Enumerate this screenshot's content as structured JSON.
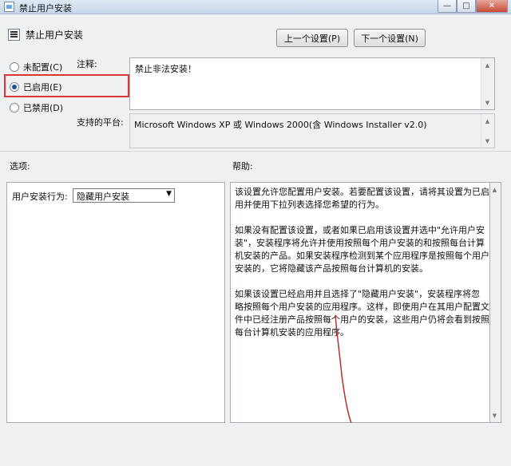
{
  "window": {
    "title": "禁止用户安装",
    "minimize_glyph": "—",
    "maximize_glyph": "□",
    "close_glyph": "✕"
  },
  "header": {
    "title": "禁止用户安装",
    "prev_button": "上一个设置(P)",
    "next_button": "下一个设置(N)"
  },
  "state": {
    "options": [
      {
        "label": "未配置(C)",
        "checked": false
      },
      {
        "label": "已启用(E)",
        "checked": true
      },
      {
        "label": "已禁用(D)",
        "checked": false
      }
    ]
  },
  "comment": {
    "label": "注释:",
    "value": "禁止非法安装！"
  },
  "platform": {
    "label": "支持的平台:",
    "value": "Microsoft Windows XP 或 Windows 2000(含 Windows Installer v2.0)"
  },
  "options_panel": {
    "heading": "选项:",
    "field_label": "用户安装行为:",
    "field_value": "隐藏用户安装"
  },
  "help_panel": {
    "heading": "帮助:",
    "lines": [
      "该设置允许您配置用户安装。若要配置该设置，请将其设置为已启",
      "用并使用下拉列表选择您希望的行为。",
      "",
      "如果没有配置该设置，或者如果已启用该设置并选中\"允许用户安",
      "装\"，安装程序将允许并使用按照每个用户安装的和按照每台计算",
      "机安装的产品。如果安装程序检测到某个应用程序是按照每个用户",
      "安装的，它将隐藏该产品按照每台计算机的安装。",
      "",
      "如果该设置已经启用并且选择了\"隐藏用户安装\"，安装程序将忽",
      "略按照每个用户安装的应用程序。这样，即使用户在其用户配置文",
      "件中已经注册产品按照每个用户的安装，这些用户仍将会看到按照",
      "每台计算机安装的应用程序。"
    ]
  },
  "colors": {
    "highlight": "#d9373a",
    "annotation_line": "#b8312f"
  }
}
